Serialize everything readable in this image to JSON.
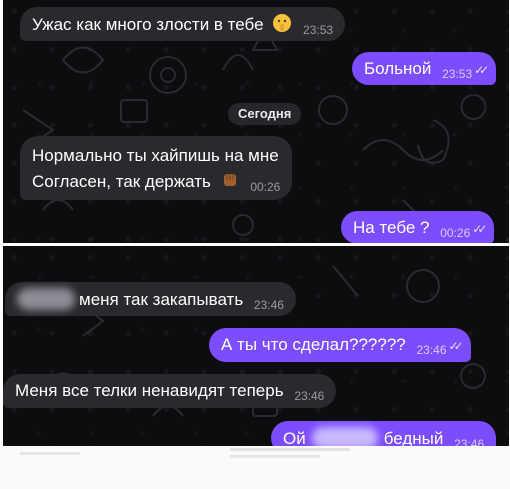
{
  "screenshot_1": {
    "date_separator": "Сегодня",
    "messages": [
      {
        "text": "Ужас как много злости в тебе",
        "time": "23:53",
        "direction": "incoming",
        "emoji": "shushing-face"
      },
      {
        "text": "Больной",
        "time": "23:53",
        "direction": "outgoing",
        "read": true
      },
      {
        "text_line1": "Нормально ты хайпишь на мне",
        "text_line2": "Согласен, так держать",
        "time": "00:26",
        "direction": "incoming",
        "emoji": "raised-fist"
      },
      {
        "text": "На тебе ?",
        "time": "00:26",
        "direction": "outgoing",
        "read": true
      }
    ]
  },
  "screenshot_2": {
    "messages": [
      {
        "text": "меня так закапывать",
        "time": "23:46",
        "direction": "incoming",
        "redacted_prefix": true
      },
      {
        "text": "А ты что сделал??????",
        "time": "23:46",
        "direction": "outgoing",
        "read": true
      },
      {
        "text": "Меня все телки ненавидят теперь",
        "time": "23:46",
        "direction": "incoming"
      },
      {
        "text_before": "Ой",
        "text_after": "бедный",
        "time": "23:46",
        "direction": "outgoing",
        "redacted_middle": true
      }
    ]
  },
  "colors": {
    "background": "#0d0d10",
    "incoming_bubble": "#2a2a2e",
    "outgoing_bubble": "#7c4dff",
    "divider": "#ffffff"
  }
}
